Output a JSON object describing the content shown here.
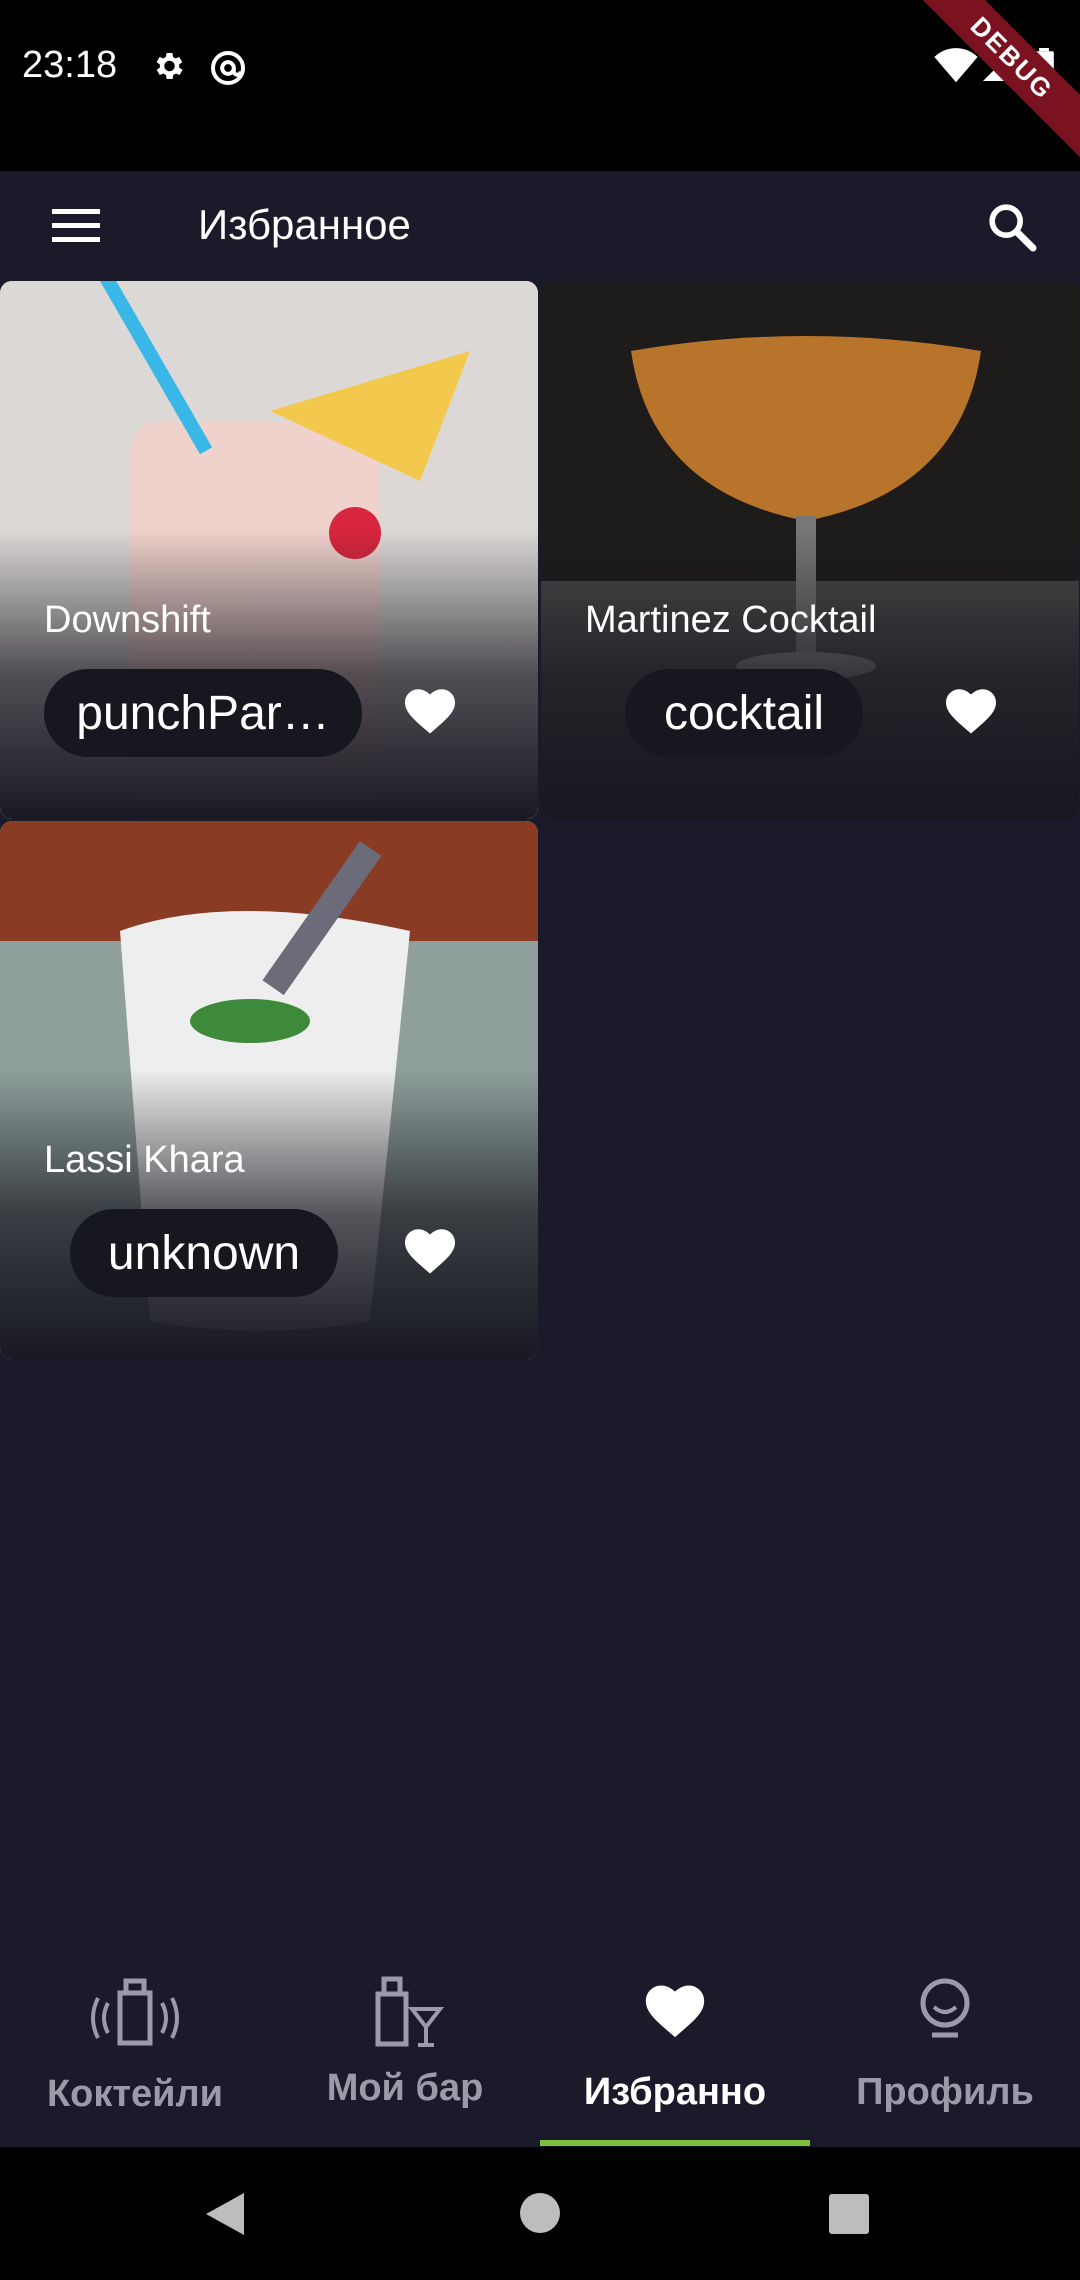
{
  "status": {
    "time": "23:18",
    "debug_label": "DEBUG"
  },
  "app_bar": {
    "title": "Избранное"
  },
  "cards": [
    {
      "title": "Downshift",
      "chip": "punchPar…",
      "bg": "#d8d4d2",
      "accent": "#f2c94c"
    },
    {
      "title": "Martinez Cocktail",
      "chip": "cocktail",
      "bg": "#2a2624",
      "accent": "#b8742a"
    },
    {
      "title": "Lassi Khara",
      "chip": "unknown",
      "bg": "#7f8c8a",
      "accent": "#eeeeee"
    }
  ],
  "nav": {
    "items": [
      {
        "label": "Коктейли",
        "icon": "shaker-icon"
      },
      {
        "label": "Мой бар",
        "icon": "bar-icon"
      },
      {
        "label": "Избранно",
        "icon": "heart-icon"
      },
      {
        "label": "Профиль",
        "icon": "profile-icon"
      }
    ],
    "active_index": 2,
    "indicator_color": "#7fbf3f"
  },
  "colors": {
    "background": "#1b1a2a",
    "chip": "#17171f"
  }
}
